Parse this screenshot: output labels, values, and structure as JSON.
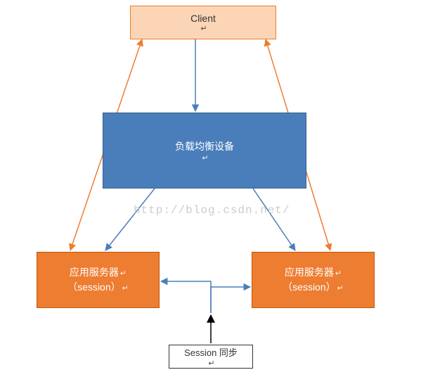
{
  "nodes": {
    "client": {
      "label": "Client"
    },
    "loadBalancer": {
      "label": "负载均衡设备"
    },
    "appServerLeft": {
      "line1": "应用服务器",
      "line2": "（session）"
    },
    "appServerRight": {
      "line1": "应用服务器",
      "line2": "（session）"
    },
    "sessionSync": {
      "label": "Session 同步"
    }
  },
  "watermark": "http://blog.csdn.net/",
  "colors": {
    "blueArrow": "#4A7EBB",
    "orangeArrow": "#ED7D31",
    "blackArrow": "#000000"
  }
}
